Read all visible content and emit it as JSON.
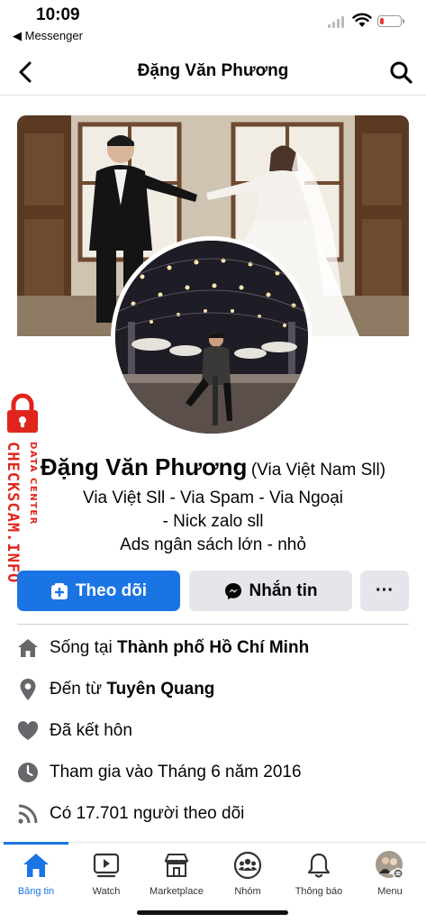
{
  "status_bar": {
    "time": "10:09",
    "back_app": "◀ Messenger",
    "battery_level": 0.2,
    "colors": {
      "battery_low": "#e53935"
    }
  },
  "nav": {
    "title": "Đặng Văn Phương",
    "back_icon": "chevron-left-icon",
    "search_icon": "search-icon"
  },
  "watermark": {
    "brand": "CHECKSCAM.INFO",
    "sub": "DATA CENTER"
  },
  "profile": {
    "name": "Đặng Văn Phương",
    "alt_name": "(Via Việt Nam Sll)",
    "bio_lines": [
      "Via Việt Sll - Via Spam - Via Ngoại",
      "- Nick zalo sll",
      "Ads ngân sách lớn - nhỏ"
    ]
  },
  "actions": {
    "follow": "Theo dõi",
    "message": "Nhắn tin",
    "more": "···"
  },
  "details": [
    {
      "icon": "home-icon",
      "prefix": "Sống tại ",
      "bold": "Thành phố Hồ Chí Minh"
    },
    {
      "icon": "location-pin-icon",
      "prefix": "Đến từ ",
      "bold": "Tuyên Quang"
    },
    {
      "icon": "heart-icon",
      "prefix": "Đã kết hôn",
      "bold": ""
    },
    {
      "icon": "clock-icon",
      "prefix": "Tham gia vào Tháng 6 năm 2016",
      "bold": ""
    },
    {
      "icon": "rss-icon",
      "prefix": "Có 17.701 người theo dõi",
      "bold": ""
    }
  ],
  "tabs": [
    {
      "label": "Bảng tin",
      "icon": "home-icon",
      "active": true
    },
    {
      "label": "Watch",
      "icon": "video-icon",
      "active": false
    },
    {
      "label": "Marketplace",
      "icon": "shop-icon",
      "active": false
    },
    {
      "label": "Nhóm",
      "icon": "groups-icon",
      "active": false
    },
    {
      "label": "Thông báo",
      "icon": "bell-icon",
      "active": false
    },
    {
      "label": "Menu",
      "icon": "profile-menu-icon",
      "active": false
    }
  ],
  "colors": {
    "accent": "#1b74e4",
    "watermark": "#e0251c",
    "button_secondary": "#e4e6eb"
  }
}
